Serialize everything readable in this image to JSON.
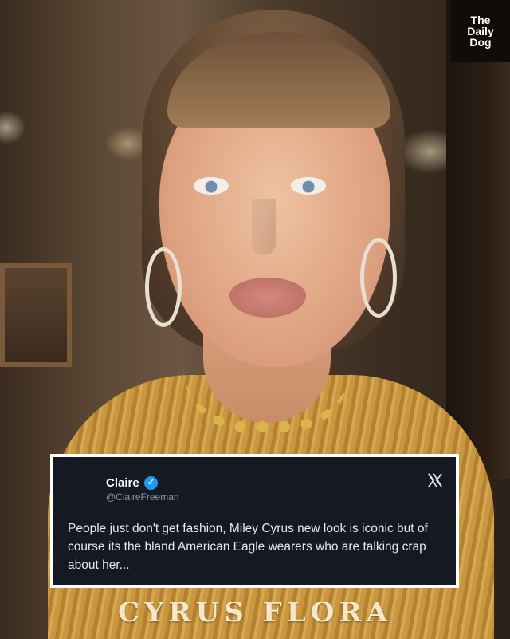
{
  "logo": {
    "line1": "The",
    "line2": "Daily",
    "line3": "Dog"
  },
  "tweet": {
    "display_name": "Claire",
    "handle": "@ClaireFreeman",
    "verified_mark": "✓",
    "platform_icon": "x-icon",
    "text": "People just don't get fashion, Miley Cyrus new look is iconic but of course its the bland American Eagle wearers who are talking crap about her..."
  },
  "image": {
    "overlay_text": "CYRUS FLORA"
  },
  "colors": {
    "tweet_bg": "#151a22",
    "tweet_border": "#ffffff",
    "verified": "#1d9bf0",
    "handle": "#8b98a5",
    "logo_bg": "#0f0c0a"
  }
}
